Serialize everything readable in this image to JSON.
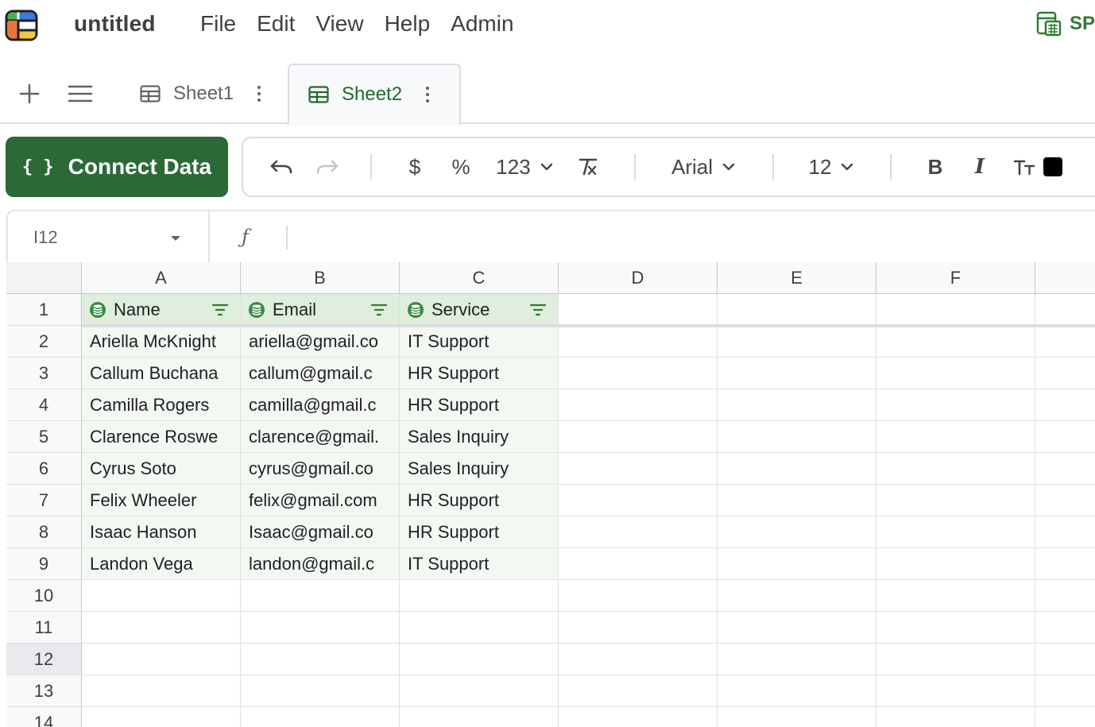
{
  "app": {
    "doc_title": "untitled",
    "menu": [
      "File",
      "Edit",
      "View",
      "Help",
      "Admin"
    ],
    "badge": "SP"
  },
  "tabs": [
    {
      "label": "Sheet1",
      "active": false
    },
    {
      "label": "Sheet2",
      "active": true
    }
  ],
  "toolbar": {
    "connect_label": "Connect Data",
    "connect_icon": "{ }",
    "number_format": "123",
    "font": "Arial",
    "font_size": "12",
    "text_color": "#000000"
  },
  "formula_bar": {
    "cell_ref": "I12",
    "fx_symbol": "ƒ",
    "value": ""
  },
  "grid": {
    "columns": [
      "A",
      "B",
      "C",
      "D",
      "E",
      "F"
    ],
    "rows": [
      "1",
      "2",
      "3",
      "4",
      "5",
      "6",
      "7",
      "8",
      "9",
      "10",
      "11",
      "12",
      "13",
      "14"
    ],
    "selected_row": "12",
    "headers": [
      "Name",
      "Email",
      "Service"
    ],
    "data": [
      [
        "Ariella McKnight",
        "ariella@gmail.co",
        "IT Support"
      ],
      [
        "Callum Buchana",
        "callum@gmail.c",
        "HR Support"
      ],
      [
        "Camilla Rogers",
        "camilla@gmail.c",
        "HR Support"
      ],
      [
        "Clarence Roswe",
        "clarence@gmail.",
        "Sales Inquiry"
      ],
      [
        "Cyrus Soto",
        "cyrus@gmail.co",
        "Sales Inquiry"
      ],
      [
        "Felix Wheeler",
        "felix@gmail.com",
        "HR Support"
      ],
      [
        "Isaac Hanson",
        "Isaac@gmail.co",
        "HR Support"
      ],
      [
        "Landon Vega",
        "landon@gmail.c",
        "IT Support"
      ]
    ]
  },
  "colors": {
    "brand_green": "#2b6a37",
    "active_tab_text": "#1e6b2a",
    "header_cell_bg": "#dfeedd",
    "data_cell_bg": "#f4f8f3"
  }
}
